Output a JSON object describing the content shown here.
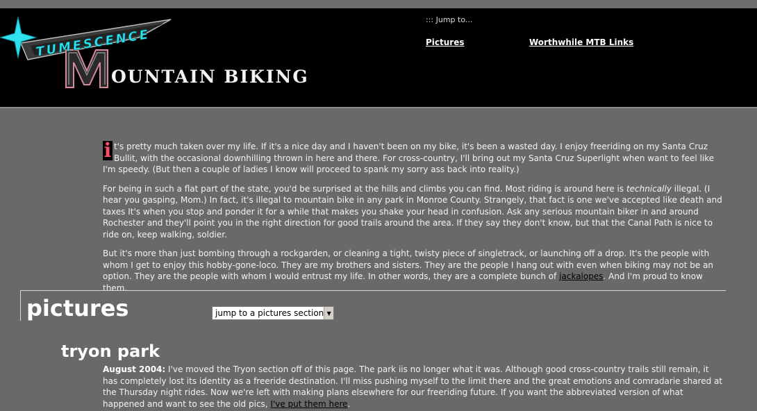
{
  "header": {
    "logo_top": "TUMESCENCE",
    "logo_cap": "M",
    "logo_rest": "OUNTAIN BIKING",
    "jump_label": "::: Jump to...",
    "nav": [
      {
        "label": "Pictures"
      },
      {
        "label": "Worthwhile MTB Links"
      }
    ]
  },
  "intro": {
    "dropcap": "i",
    "p1": "t's pretty much taken over my life. If it's a nice day and I haven't been on my bike, it's been a wasted day. I enjoy freeriding on my Santa Cruz Bullit, with the occasional downhilling thrown in here and there. For cross-country, I'll bring out my Santa Cruz Superlight when want to feel like I'm speedy. (But then a couple of ladies I know will proceed to spank my sorry ass back into reality.)",
    "p2_a": "For being in such a flat part of the state, you'd be surprised at the hills and climbs you can find. Most riding is around here is ",
    "p2_em": "technically",
    "p2_b": " illegal. (I hear you gasping, Mom.) In fact, it's illegal to mountain bike in any park in Monroe County. Strangely, that fact is one we've accepted like death and taxes It's when you stop and ponder it for a while that makes you shake your head in confusion. Ask any serious mountain biker in and around Rochester and they'll point you in the right direction for good trails around the area. If they say they don't know, but that the Canal Path is nice to ride on, keep walking, soldier.",
    "p3_a": "But it's more than just bombing through a rockgarden, or cleaning a tight, twisty piece of singletrack, or launching off a drop. It's the people with whom I get to enjoy this hobby-gone-loco. They are my brothers and sisters. They are the people I hang out with even when biking may not be an option. They are the people with whom I would entrust my life. In other words, they are a complete bunch of ",
    "p3_link": "jackalopes",
    "p3_b": ". And I'm proud to know them."
  },
  "pictures": {
    "title": "pictures",
    "select_value": "jump to a pictures section",
    "section": {
      "title": "tryon park",
      "date_label": "August 2004:",
      "body": " I've moved the Tryon section off of this page. The park iis no longer what it was. Although good cross-country trails still remain, it has completely lost its identity as a freeride destination. I'll miss pushing myself to the limit there and the great emotions and comradarie shared at the Thursday night rides. Now we're left with making plans elsewhere for our freeriding future. If you want the abbreviated version of what happened and want to see the old pics, ",
      "link": "I've put them here",
      "end": "."
    }
  },
  "colors": {
    "background": "#696969",
    "header_bg": "#000000",
    "accent_cyan": "#2fe0f0",
    "dropcap": "#ff4a6a"
  }
}
